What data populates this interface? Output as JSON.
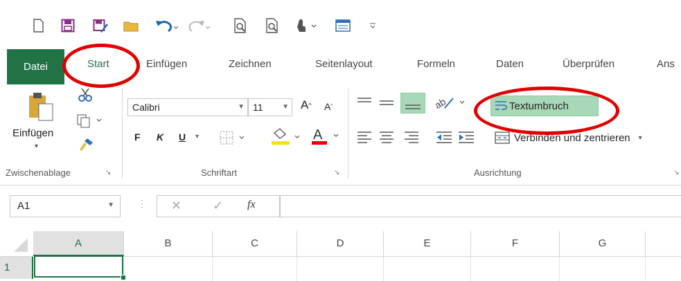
{
  "ribbon_tabs": {
    "file": "Datei",
    "start": "Start",
    "insert": "Einfügen",
    "draw": "Zeichnen",
    "page_layout": "Seitenlayout",
    "formulas": "Formeln",
    "data": "Daten",
    "review": "Überprüfen",
    "view_partial": "Ans"
  },
  "clipboard": {
    "paste_label": "Einfügen",
    "group_label": "Zwischenablage"
  },
  "font": {
    "font_name": "Calibri",
    "font_size": "11",
    "bold": "F",
    "italic": "K",
    "underline": "U",
    "group_label": "Schriftart"
  },
  "alignment": {
    "wrap_text": "Textumbruch",
    "merge_center": "Verbinden und zentrieren",
    "group_label": "Ausrichtung"
  },
  "formula_bar": {
    "name_box": "A1",
    "fx": "fx",
    "formula_value": ""
  },
  "sheet": {
    "columns": [
      "A",
      "B",
      "C",
      "D",
      "E",
      "F",
      "G"
    ],
    "rows": [
      "1"
    ]
  },
  "colors": {
    "excel_green": "#217346",
    "highlight_green": "#a9d8b8",
    "annotation_red": "#e00000"
  }
}
